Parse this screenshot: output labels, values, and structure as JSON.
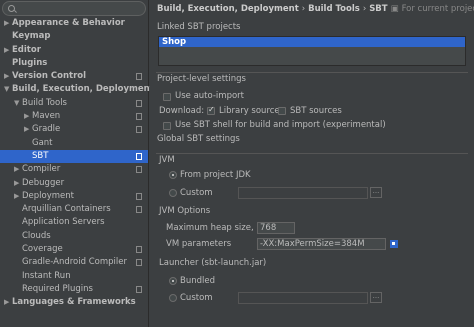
{
  "sidebar": {
    "items": [
      {
        "label": "Appearance & Behavior",
        "arrow": "▶"
      },
      {
        "label": "Keymap",
        "arrow": ""
      },
      {
        "label": "Editor",
        "arrow": "▶"
      },
      {
        "label": "Plugins",
        "arrow": ""
      },
      {
        "label": "Version Control",
        "arrow": "▶"
      },
      {
        "label": "Build, Execution, Deployment",
        "arrow": "▼"
      },
      {
        "label": "Build Tools",
        "arrow": "▼"
      },
      {
        "label": "Maven",
        "arrow": "▶"
      },
      {
        "label": "Gradle",
        "arrow": "▶"
      },
      {
        "label": "Gant",
        "arrow": ""
      },
      {
        "label": "SBT",
        "arrow": ""
      },
      {
        "label": "Compiler",
        "arrow": "▶"
      },
      {
        "label": "Debugger",
        "arrow": "▶"
      },
      {
        "label": "Deployment",
        "arrow": "▶"
      },
      {
        "label": "Arquillian Containers",
        "arrow": ""
      },
      {
        "label": "Application Servers",
        "arrow": ""
      },
      {
        "label": "Clouds",
        "arrow": ""
      },
      {
        "label": "Coverage",
        "arrow": ""
      },
      {
        "label": "Gradle-Android Compiler",
        "arrow": ""
      },
      {
        "label": "Instant Run",
        "arrow": ""
      },
      {
        "label": "Required Plugins",
        "arrow": ""
      },
      {
        "label": "Languages & Frameworks",
        "arrow": "▶"
      }
    ]
  },
  "breadcrumb": {
    "part1": "Build, Execution, Deployment",
    "sep": "›",
    "part2": "Build Tools",
    "part3": "SBT",
    "project_note": "For current project"
  },
  "linked_projects": {
    "title": "Linked SBT projects",
    "items": [
      "Shop"
    ]
  },
  "project_settings": {
    "title": "Project-level settings",
    "auto_import": "Use auto-import",
    "download_label": "Download:",
    "library_sources": "Library sources",
    "sbt_sources": "SBT sources",
    "sbt_shell": "Use SBT shell for build and import (experimental)"
  },
  "global_settings": {
    "title": "Global SBT settings",
    "jvm_title": "JVM",
    "from_project_jdk": "From project JDK",
    "custom": "Custom",
    "jvm_options_title": "JVM Options",
    "heap_label": "Maximum heap size, MB",
    "heap_value": "768",
    "vm_params_label": "VM parameters",
    "vm_params_value": "-XX:MaxPermSize=384M",
    "launcher_title": "Launcher (sbt-launch.jar)",
    "bundled": "Bundled",
    "launcher_custom": "Custom",
    "browse": "..."
  }
}
